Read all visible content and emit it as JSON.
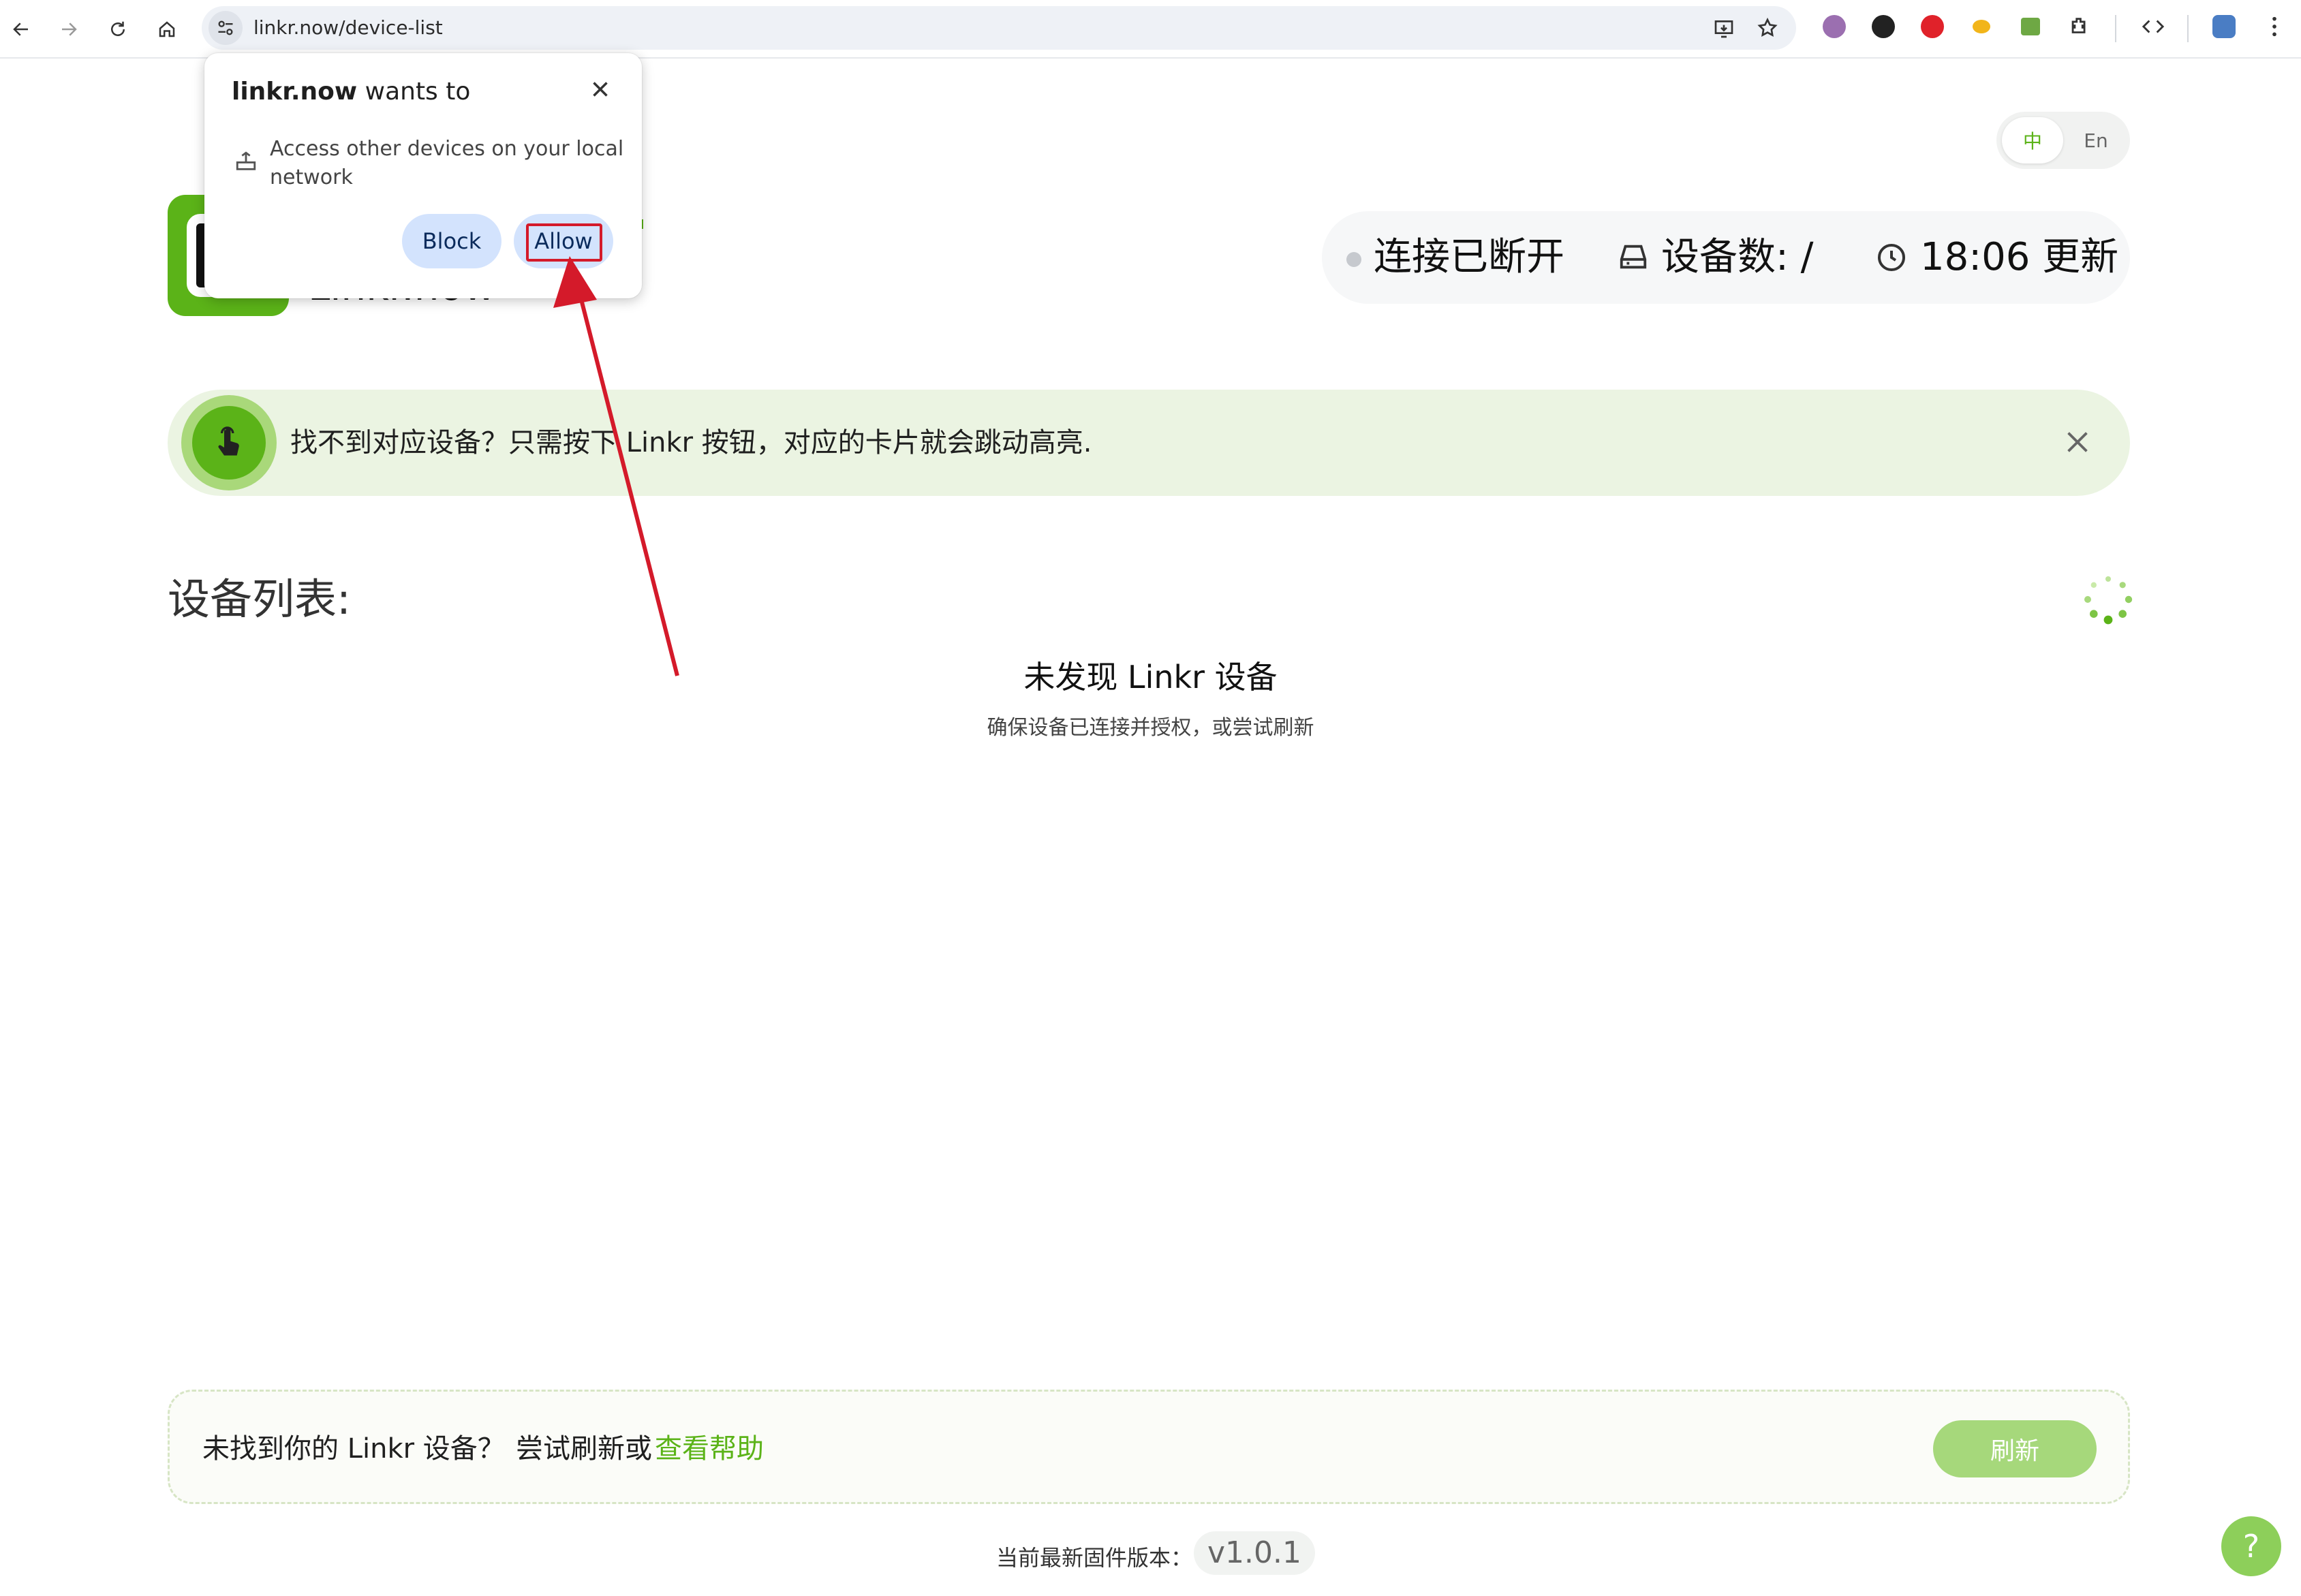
{
  "browser": {
    "url": "linkr.now/device-list"
  },
  "permission": {
    "site": "linkr.now",
    "wants_to": "wants to",
    "description": "Access other devices on your local network",
    "block_label": "Block",
    "allow_label": "Allow"
  },
  "header": {
    "logo_text": "Linkr.now",
    "lang": {
      "zh": "中",
      "en": "En",
      "selected": "中"
    },
    "status": {
      "connection": "连接已断开",
      "device_count": "设备数: /",
      "updated": "18:06 更新"
    }
  },
  "hint": {
    "text": "找不到对应设备？只需按下 Linkr 按钮，对应的卡片就会跳动高亮."
  },
  "device_list": {
    "title": "设备列表:",
    "empty_title": "未发现 Linkr 设备",
    "empty_subtitle": "确保设备已连接并授权，或尝试刷新"
  },
  "footer": {
    "question": "未找到你的 Linkr 设备？",
    "try_text": "尝试刷新或",
    "help_link": "查看帮助",
    "refresh_label": "刷新",
    "firmware_label": "当前最新固件版本：",
    "firmware_version": "v1.0.1",
    "help_fab": "?"
  },
  "colors": {
    "accent": "#5bb318",
    "annotation": "#d41a2a",
    "hint_bg": "#ebf4e2"
  }
}
